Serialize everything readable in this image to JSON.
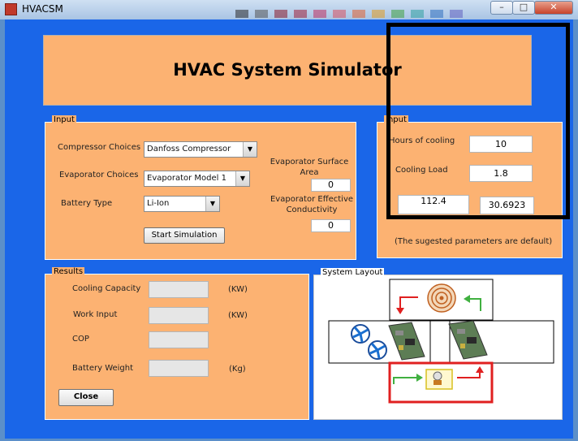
{
  "window": {
    "title": "HVACSM",
    "buttons": {
      "minimize": "–",
      "maximize": "□",
      "close": "✕"
    },
    "palette_colors": [
      "#2a2a2a",
      "#555555",
      "#8a1a2a",
      "#a0203a",
      "#c03060",
      "#d85060",
      "#e06030",
      "#e09a20",
      "#40a040",
      "#30a0a0",
      "#3070c0",
      "#6060c0"
    ]
  },
  "header": {
    "title": "HVAC System Simulator"
  },
  "input_panel": {
    "label": "Input",
    "compressor_label": "Compressor Choices",
    "compressor_value": "Danfoss Compressor",
    "evaporator_label": "Evaporator Choices",
    "evaporator_value": "Evaporator Model 1",
    "battery_label": "Battery Type",
    "battery_value": "Li-Ion",
    "surface_area_label": "Evaporator Surface Area",
    "surface_area_value": "0",
    "conductivity_label": "Evaporator Effective Conductivity",
    "conductivity_value": "0",
    "start_button": "Start Simulation"
  },
  "input2_panel": {
    "label": "Input",
    "hours_label": "Hours of cooling",
    "hours_value": "10",
    "load_label": "Cooling Load",
    "load_value": "1.8",
    "value_a": "112.4",
    "value_b": "30.6923",
    "note": "(The sugested parameters are default)"
  },
  "results_panel": {
    "label": "Results",
    "cooling_capacity_label": "Cooling Capacity",
    "cooling_capacity_unit": "(KW)",
    "work_input_label": "Work Input",
    "work_input_unit": "(KW)",
    "cop_label": "COP",
    "battery_weight_label": "Battery Weight",
    "battery_weight_unit": "(Kg)",
    "close_button": "Close"
  },
  "layout_panel": {
    "label": "System Layout"
  },
  "colors": {
    "client_bg": "#1a66e8",
    "panel_bg": "#fcb272",
    "highlight_red": "#e02020",
    "arrow_green": "#40b040"
  }
}
